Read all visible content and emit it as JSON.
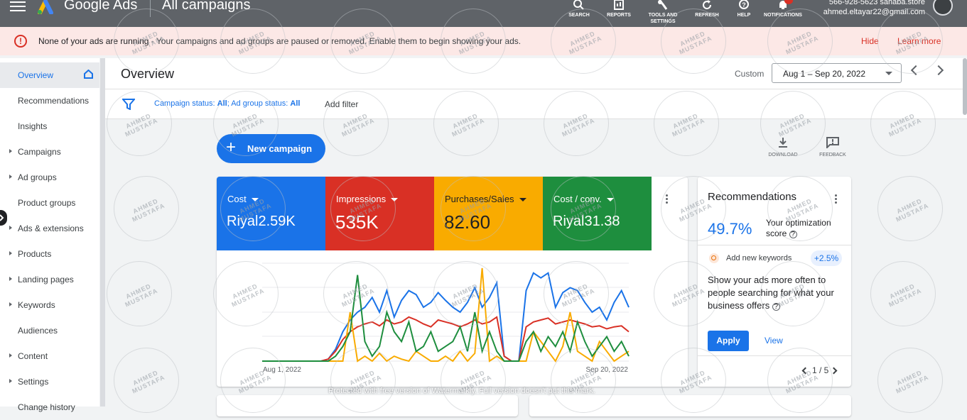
{
  "topbar": {
    "brand": "Google Ads",
    "title": "All campaigns",
    "tools": [
      {
        "label": "SEARCH",
        "icon": "search-icon"
      },
      {
        "label": "REPORTS",
        "icon": "reports-icon"
      },
      {
        "label": "TOOLS AND SETTINGS",
        "icon": "wrench-icon"
      },
      {
        "label": "REFRESH",
        "icon": "refresh-icon"
      },
      {
        "label": "HELP",
        "icon": "help-icon"
      },
      {
        "label": "NOTIFICATIONS",
        "icon": "bell-icon"
      }
    ],
    "account_id": "566-928-5623 sahaba.store",
    "account_email": "ahmed.eltayar22@gmail.com"
  },
  "banner": {
    "lead": "None of your ads are running",
    "message": " - Your campaigns and ad groups are paused or removed. Enable them to begin showing your ads.",
    "hide_label": "Hide",
    "learn_label": "Learn more"
  },
  "sidebar": {
    "items": [
      {
        "label": "Overview",
        "active": true,
        "expandable": false
      },
      {
        "label": "Recommendations",
        "expandable": false
      },
      {
        "label": "Insights",
        "expandable": false
      },
      {
        "label": "Campaigns",
        "expandable": true
      },
      {
        "label": "Ad groups",
        "expandable": true
      },
      {
        "label": "Product groups",
        "expandable": false
      },
      {
        "label": "Ads & extensions",
        "expandable": true
      },
      {
        "label": "Products",
        "expandable": true
      },
      {
        "label": "Landing pages",
        "expandable": true
      },
      {
        "label": "Keywords",
        "expandable": true
      },
      {
        "label": "Audiences",
        "expandable": false
      },
      {
        "label": "Content",
        "expandable": true
      },
      {
        "label": "Settings",
        "expandable": true
      },
      {
        "label": "Change history",
        "expandable": false
      }
    ]
  },
  "header": {
    "title": "Overview",
    "custom_label": "Custom",
    "date_range": "Aug 1 – Sep 20, 2022"
  },
  "filter": {
    "campaign_status_label": "Campaign status: ",
    "campaign_status_value": "All",
    "adgroup_status_label": "; Ad group status: ",
    "adgroup_status_value": "All",
    "add_filter": "Add filter"
  },
  "actions": {
    "new_campaign": "New campaign",
    "download": "DOWNLOAD",
    "feedback": "FEEDBACK"
  },
  "metrics": [
    {
      "name": "Cost",
      "value": "Riyal2.59K",
      "color": "#1a73e8"
    },
    {
      "name": "Impressions",
      "value": "535K",
      "color": "#d93025"
    },
    {
      "name": "Purchases/Sales",
      "value": "82.60",
      "color": "#f9ab00"
    },
    {
      "name": "Cost / conv.",
      "value": "Riyal31.38",
      "color": "#1e8e3e"
    }
  ],
  "chart_data": {
    "type": "line",
    "x_start_label": "Aug 1, 2022",
    "x_end_label": "Sep 20, 2022",
    "series": [
      {
        "name": "Cost",
        "color": "#1a73e8",
        "values": [
          0,
          0,
          0,
          0,
          0,
          0,
          0,
          0,
          0,
          0.02,
          0.12,
          0.3,
          0.42,
          0.5,
          0.55,
          0.65,
          0.5,
          0.72,
          0.45,
          0.62,
          0.72,
          0.68,
          0.55,
          0.6,
          0.7,
          0.62,
          0.55,
          0.5,
          0.6,
          0.75,
          0.55,
          0.65,
          0.8,
          0.05,
          0,
          0,
          0.72,
          0.9,
          0.85,
          0.9,
          0.55,
          0.7,
          0.75,
          0.72,
          0.6,
          0.5,
          0.55,
          0.42,
          0.6,
          0.72,
          0.55
        ]
      },
      {
        "name": "Impressions",
        "color": "#d93025",
        "values": [
          0,
          0,
          0,
          0,
          0,
          0,
          0,
          0,
          0,
          0.02,
          0.1,
          0.22,
          0.3,
          0.35,
          0.38,
          0.4,
          0.36,
          0.42,
          0.38,
          0.4,
          0.45,
          0.42,
          0.38,
          0.35,
          0.42,
          0.4,
          0.38,
          0.35,
          0.38,
          0.42,
          0.38,
          0.4,
          0.45,
          0.05,
          0,
          0,
          0.35,
          0.4,
          0.42,
          0.44,
          0.38,
          0.4,
          0.42,
          0.4,
          0.38,
          0.35,
          0.36,
          0.33,
          0.35,
          0.36,
          0.3
        ]
      },
      {
        "name": "Purchases/Sales",
        "color": "#f9ab00",
        "values": [
          0,
          0,
          0,
          0,
          0,
          0,
          0,
          0,
          0,
          0,
          0,
          0,
          0.5,
          0,
          0.05,
          0,
          0.08,
          0,
          0.05,
          0.02,
          0,
          0.1,
          0.05,
          0,
          0,
          0.05,
          0,
          0.1,
          0,
          0.08,
          0.95,
          0,
          0.05,
          0,
          0,
          0,
          0,
          0.3,
          0.2,
          0.1,
          0,
          0.15,
          0.5,
          0.1,
          0.05,
          0,
          0.2,
          0.1,
          0,
          0.05,
          0.1
        ]
      },
      {
        "name": "Cost / conv.",
        "color": "#1e8e3e",
        "values": [
          0,
          0,
          0,
          0,
          0,
          0,
          0,
          0,
          0,
          0,
          0.05,
          0.15,
          0.3,
          0.88,
          0.2,
          0.05,
          0.15,
          0.5,
          0.3,
          0.2,
          0.4,
          0.1,
          0.15,
          0.3,
          0.1,
          0.15,
          0.2,
          0.35,
          0.1,
          0.5,
          0.1,
          0.3,
          0.1,
          0,
          0,
          0,
          0.2,
          0.3,
          0.1,
          0.25,
          0.15,
          0.3,
          0.1,
          0.4,
          0.2,
          0.05,
          0.15,
          0.25,
          0.1,
          0.2,
          0.05
        ]
      }
    ]
  },
  "recommendations": {
    "title": "Recommendations",
    "score": "49.7%",
    "score_label": "Your optimization score",
    "item_title": "Add new keywords",
    "item_uplift": "+2.5%",
    "description": "Show your ads more often to people searching for what your business offers",
    "apply": "Apply",
    "view": "View",
    "pager": "1 / 5"
  },
  "watermark": {
    "stamp_text": "AHMED MUSTAFA",
    "notice": "Protected with free version of Watermarkly. Full version doesn't put this mark."
  }
}
